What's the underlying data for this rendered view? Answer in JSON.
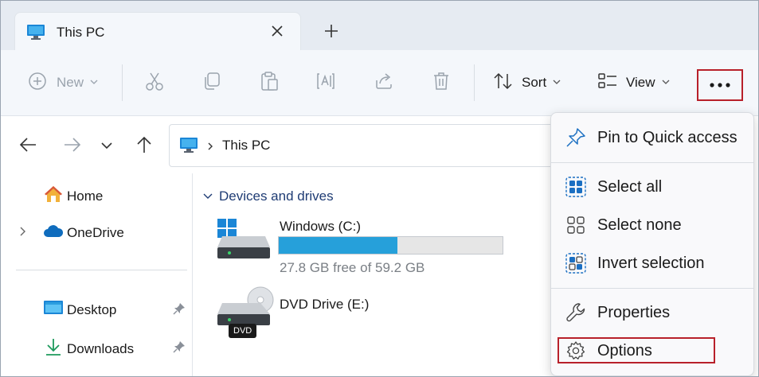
{
  "tab": {
    "title": "This PC",
    "icon": "monitor-icon"
  },
  "toolbar": {
    "new_label": "New",
    "sort_label": "Sort",
    "view_label": "View"
  },
  "address": {
    "text": "This PC"
  },
  "sidebar": {
    "items": [
      {
        "label": "Home",
        "icon": "home-icon"
      },
      {
        "label": "OneDrive",
        "icon": "cloud-icon"
      },
      {
        "label": "Desktop",
        "icon": "desktop-icon"
      },
      {
        "label": "Downloads",
        "icon": "download-icon"
      }
    ]
  },
  "main": {
    "section_label": "Devices and drives",
    "drives": [
      {
        "name": "Windows (C:)",
        "free_text": "27.8 GB free of 59.2 GB",
        "used_fraction": 0.53
      },
      {
        "name": "DVD Drive (E:)",
        "badge": "DVD"
      }
    ]
  },
  "menu": {
    "items": [
      {
        "label": "Pin to Quick access",
        "icon": "pin-icon"
      },
      {
        "label": "Select all",
        "icon": "select-all-icon"
      },
      {
        "label": "Select none",
        "icon": "select-none-icon"
      },
      {
        "label": "Invert selection",
        "icon": "invert-selection-icon"
      },
      {
        "label": "Properties",
        "icon": "wrench-icon"
      },
      {
        "label": "Options",
        "icon": "gear-icon"
      }
    ]
  },
  "colors": {
    "accent": "#26a0da",
    "highlight": "#b8202a",
    "link": "#1f3c74"
  }
}
